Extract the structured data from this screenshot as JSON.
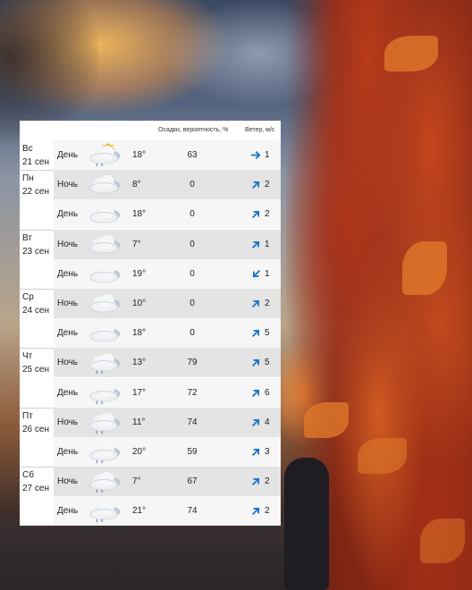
{
  "header": {
    "precip_label": "Осадки, вероятность, %",
    "wind_label": "Ветер, м/с"
  },
  "colors": {
    "accent": "#1a73c8",
    "row_dark": "#e4e4e4",
    "row_light": "#f6f6f6"
  },
  "days": [
    {
      "name": "Вс",
      "date": "21 сен",
      "rows": [
        {
          "part": "День",
          "icon": "partly-cloudy-rain-icon",
          "temp": "18°",
          "precip": "63",
          "wind": "1",
          "dir": "east"
        }
      ]
    },
    {
      "name": "Пн",
      "date": "22 сен",
      "rows": [
        {
          "part": "Ночь",
          "icon": "cloudy-icon",
          "temp": "8°",
          "precip": "0",
          "wind": "2",
          "dir": "northeast"
        },
        {
          "part": "День",
          "icon": "cloudy-icon",
          "temp": "18°",
          "precip": "0",
          "wind": "2",
          "dir": "northeast"
        }
      ]
    },
    {
      "name": "Вт",
      "date": "23 сен",
      "rows": [
        {
          "part": "Ночь",
          "icon": "cloudy-icon",
          "temp": "7°",
          "precip": "0",
          "wind": "1",
          "dir": "northeast"
        },
        {
          "part": "День",
          "icon": "cloudy-icon",
          "temp": "19°",
          "precip": "0",
          "wind": "1",
          "dir": "southwest"
        }
      ]
    },
    {
      "name": "Ср",
      "date": "24 сен",
      "rows": [
        {
          "part": "Ночь",
          "icon": "partly-cloudy-night-icon",
          "temp": "10°",
          "precip": "0",
          "wind": "2",
          "dir": "northeast"
        },
        {
          "part": "День",
          "icon": "cloudy-icon",
          "temp": "18°",
          "precip": "0",
          "wind": "5",
          "dir": "northeast"
        }
      ]
    },
    {
      "name": "Чт",
      "date": "25 сен",
      "rows": [
        {
          "part": "Ночь",
          "icon": "partly-cloudy-night-rain-icon",
          "temp": "13°",
          "precip": "79",
          "wind": "5",
          "dir": "northeast"
        },
        {
          "part": "День",
          "icon": "cloudy-rain-icon",
          "temp": "17°",
          "precip": "72",
          "wind": "6",
          "dir": "northeast"
        }
      ]
    },
    {
      "name": "Пт",
      "date": "26 сен",
      "rows": [
        {
          "part": "Ночь",
          "icon": "cloudy-rain-icon",
          "temp": "11°",
          "precip": "74",
          "wind": "4",
          "dir": "northeast"
        },
        {
          "part": "День",
          "icon": "cloudy-rain-icon",
          "temp": "20°",
          "precip": "59",
          "wind": "3",
          "dir": "northeast"
        }
      ]
    },
    {
      "name": "Сб",
      "date": "27 сен",
      "rows": [
        {
          "part": "Ночь",
          "icon": "cloudy-rain-icon",
          "temp": "7°",
          "precip": "67",
          "wind": "2",
          "dir": "northeast"
        },
        {
          "part": "День",
          "icon": "cloudy-rain-icon",
          "temp": "21°",
          "precip": "74",
          "wind": "2",
          "dir": "northeast"
        }
      ]
    }
  ]
}
